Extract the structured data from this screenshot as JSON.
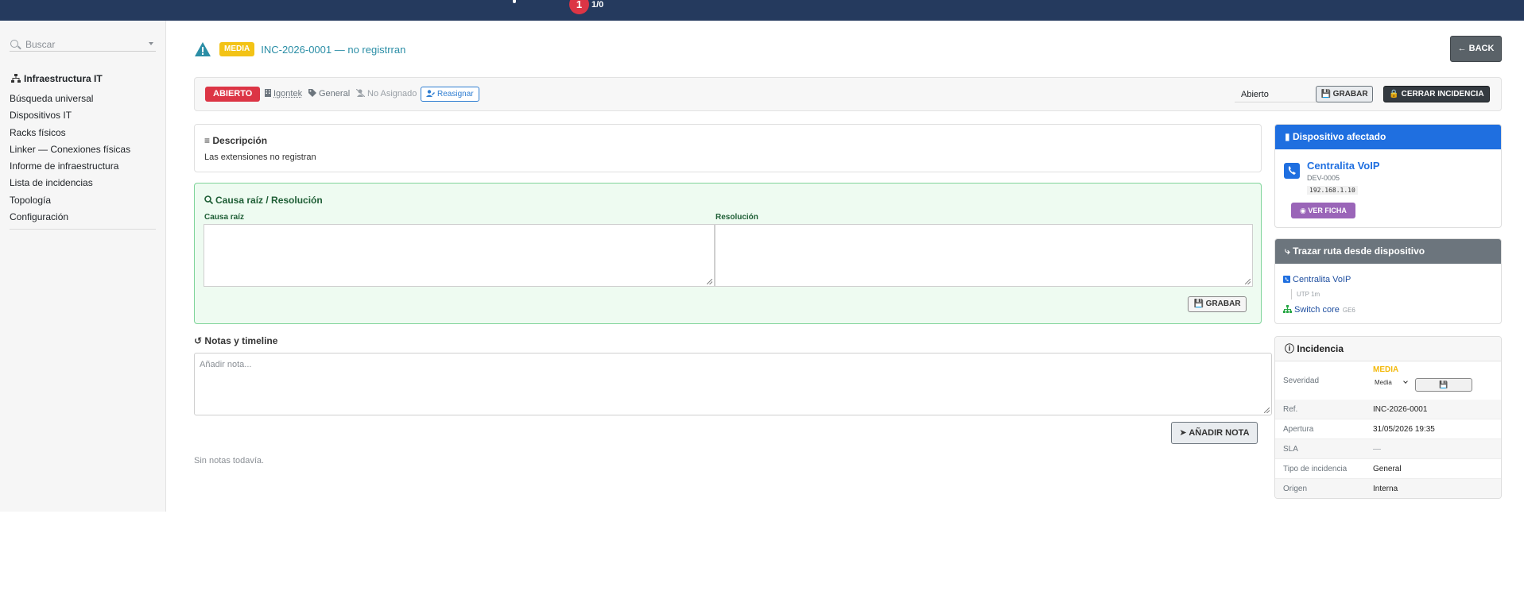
{
  "topbar": {
    "notification_count": "1",
    "counter": "1/0"
  },
  "sidebar": {
    "search_placeholder": "Buscar",
    "section_title": "Infraestructura IT",
    "items": [
      {
        "label": "Búsqueda universal"
      },
      {
        "label": "Dispositivos IT"
      },
      {
        "label": "Racks físicos"
      },
      {
        "label": "Linker — Conexiones físicas"
      },
      {
        "label": "Informe de infraestructura"
      },
      {
        "label": "Lista de incidencias"
      },
      {
        "label": "Topología"
      },
      {
        "label": "Configuración"
      }
    ]
  },
  "header": {
    "severity_badge": "MEDIA",
    "title": "INC-2026-0001 — no registrran",
    "back_label": "BACK"
  },
  "status_bar": {
    "status_badge": "ABIERTO",
    "owner": "Igontek",
    "tag": "General",
    "assignee": "No Asignado",
    "reassign_label": "Reasignar",
    "state_select_value": "Abierto",
    "save_label": "GRABAR",
    "close_label": "CERRAR INCIDENCIA"
  },
  "description": {
    "title": "Descripción",
    "text": "Las extensiones no registran"
  },
  "root_cause": {
    "title": "Causa raíz / Resolución",
    "cause_label": "Causa raíz",
    "resolution_label": "Resolución",
    "save_label": "GRABAR"
  },
  "notes": {
    "title": "Notas y timeline",
    "placeholder": "Añadir nota...",
    "add_label": "AÑADIR NOTA",
    "empty_text": "Sin notas todavía."
  },
  "affected_device": {
    "title": "Dispositivo afectado",
    "name": "Centralita VoIP",
    "code": "DEV-0005",
    "ip": "192.168.1.10",
    "view_label": "VER FICHA"
  },
  "route": {
    "title": "Trazar ruta desde dispositivo",
    "from": "Centralita VoIP",
    "link": "UTP 1m",
    "to": "Switch core",
    "to_port": "GE6"
  },
  "incident": {
    "title": "Incidencia",
    "severity_label": "Severidad",
    "severity_value": "MEDIA",
    "severity_select": "Media",
    "rows": [
      {
        "key": "Ref.",
        "value": "INC-2026-0001"
      },
      {
        "key": "Apertura",
        "value": "31/05/2026 19:35"
      },
      {
        "key": "SLA",
        "value": "—"
      },
      {
        "key": "Tipo de incidencia",
        "value": "General"
      },
      {
        "key": "Origen",
        "value": "Interna"
      }
    ]
  },
  "colors": {
    "topbar": "#253a5e",
    "danger": "#dc3545",
    "warning": "#f3c316",
    "primary": "#1f6fe0",
    "success_bg": "#eefbf1"
  }
}
